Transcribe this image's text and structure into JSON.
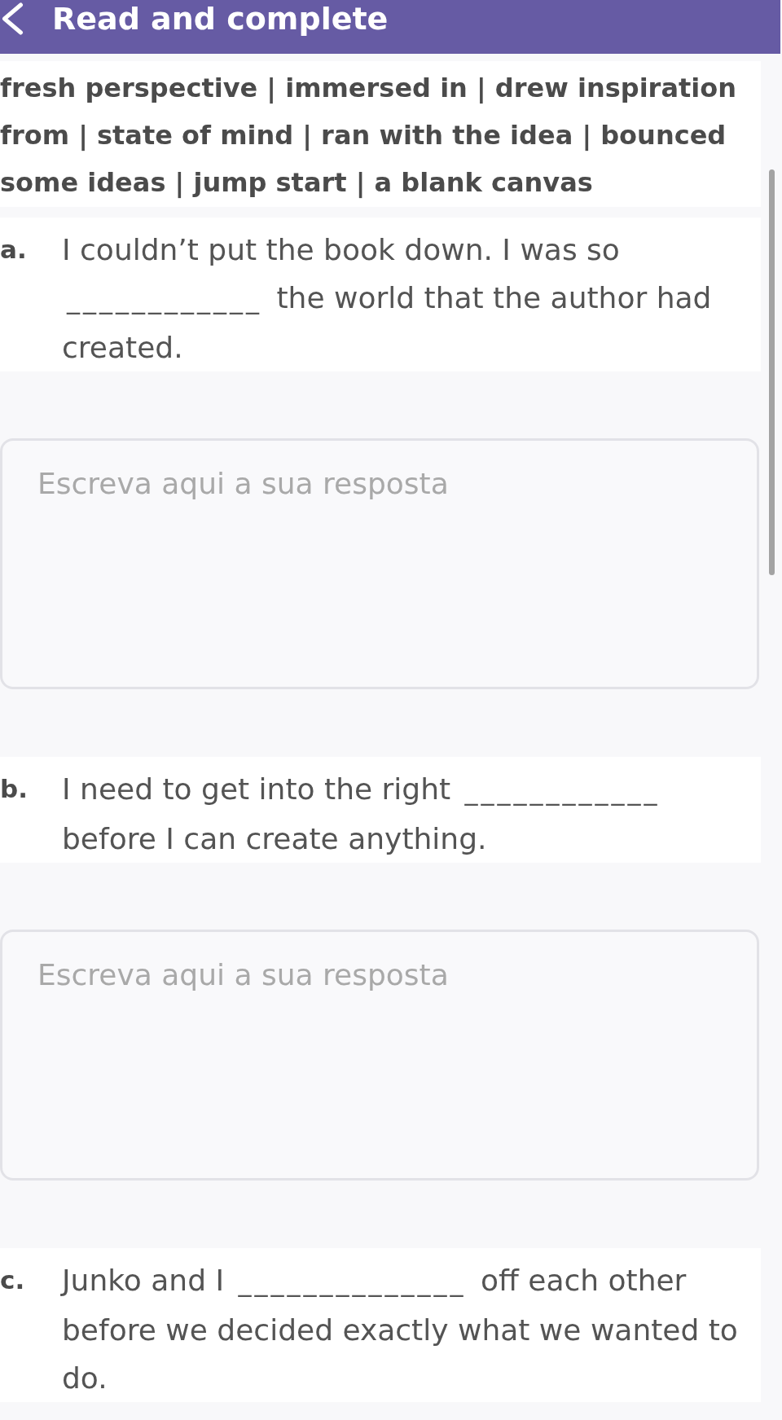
{
  "header": {
    "title": "Read and complete"
  },
  "word_bank": {
    "text": "fresh perspective | immersed in | drew inspiration from | state of mind | ran with the idea | bounced some ideas | jump start | a blank canvas"
  },
  "questions": [
    {
      "label": "a.",
      "before": "I couldn’t put the book down. I was so",
      "blank": "____________",
      "after": "the world that the author had created.",
      "answer": {
        "placeholder": "Escreva aqui a sua resposta"
      }
    },
    {
      "label": "b.",
      "before": "I need to get into the right",
      "blank": "____________",
      "after": "before I can create anything.",
      "answer": {
        "placeholder": "Escreva aqui a sua resposta"
      }
    },
    {
      "label": "c.",
      "before": "Junko and I",
      "blank": "______________",
      "after": "off each other before we decided exactly what we wanted to do."
    }
  ]
}
